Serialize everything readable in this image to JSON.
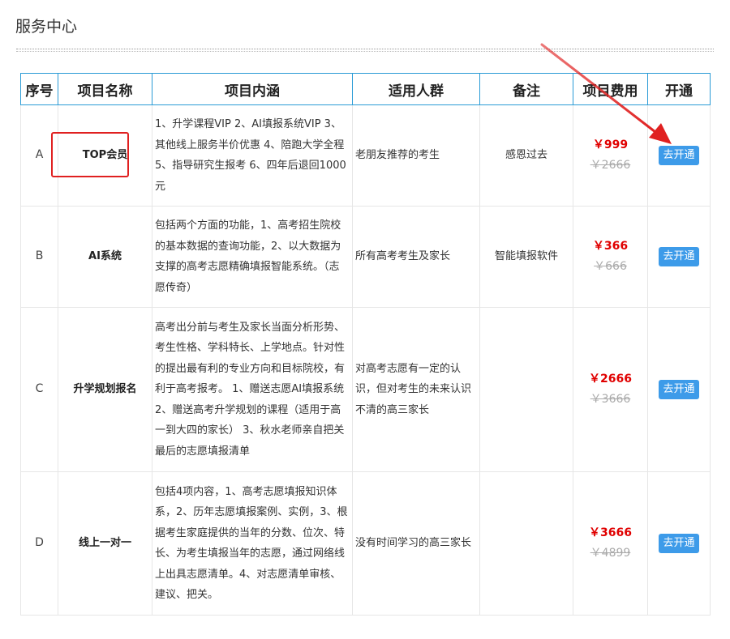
{
  "page": {
    "title": "服务中心"
  },
  "table": {
    "headers": [
      "序号",
      "项目名称",
      "项目内涵",
      "适用人群",
      "备注",
      "项目费用",
      "开通"
    ],
    "rows": [
      {
        "index": "A",
        "name": "TOP会员",
        "content": "1、升学课程VIP 2、AI填报系统VIP 3、其他线上服务半价优惠 4、陪跑大学全程 5、指导研究生报考 6、四年后退回1000元",
        "target": "老朋友推荐的考生",
        "note": "感恩过去",
        "price_now": "￥999",
        "price_old": "￥2666",
        "button": "去开通"
      },
      {
        "index": "B",
        "name": "AI系统",
        "content": "包括两个方面的功能，1、高考招生院校的基本数据的查询功能，2、以大数据为支撑的高考志愿精确填报智能系统。（志愿传奇）",
        "target": "所有高考考生及家长",
        "note": "智能填报软件",
        "price_now": "￥366",
        "price_old": "￥666",
        "button": "去开通"
      },
      {
        "index": "C",
        "name": "升学规划报名",
        "content": "高考出分前与考生及家长当面分析形势、考生性格、学科特长、上学地点。针对性的提出最有利的专业方向和目标院校，有利于高考报考。 1、赠送志愿AI填报系统 2、赠送高考升学规划的课程（适用于高一到大四的家长） 3、秋水老师亲自把关最后的志愿填报清单",
        "target": "对高考志愿有一定的认识，但对考生的未来认识不清的高三家长",
        "note": "",
        "price_now": "￥2666",
        "price_old": "￥3666",
        "button": "去开通"
      },
      {
        "index": "D",
        "name": "线上一对一",
        "content": "包括4项内容，1、高考志愿填报知识体系，2、历年志愿填报案例、实例，3、根据考生家庭提供的当年的分数、位次、特长、为考生填报当年的志愿，通过网络线上出具志愿清单。4、对志愿清单审核、建议、把关。",
        "target": "没有时间学习的高三家长",
        "note": "",
        "price_now": "￥3666",
        "price_old": "￥4899",
        "button": "去开通"
      }
    ]
  },
  "annotations": {
    "highlight_color": "#e02020",
    "accent_color": "#2a9bd6",
    "button_color": "#3d9be9"
  }
}
